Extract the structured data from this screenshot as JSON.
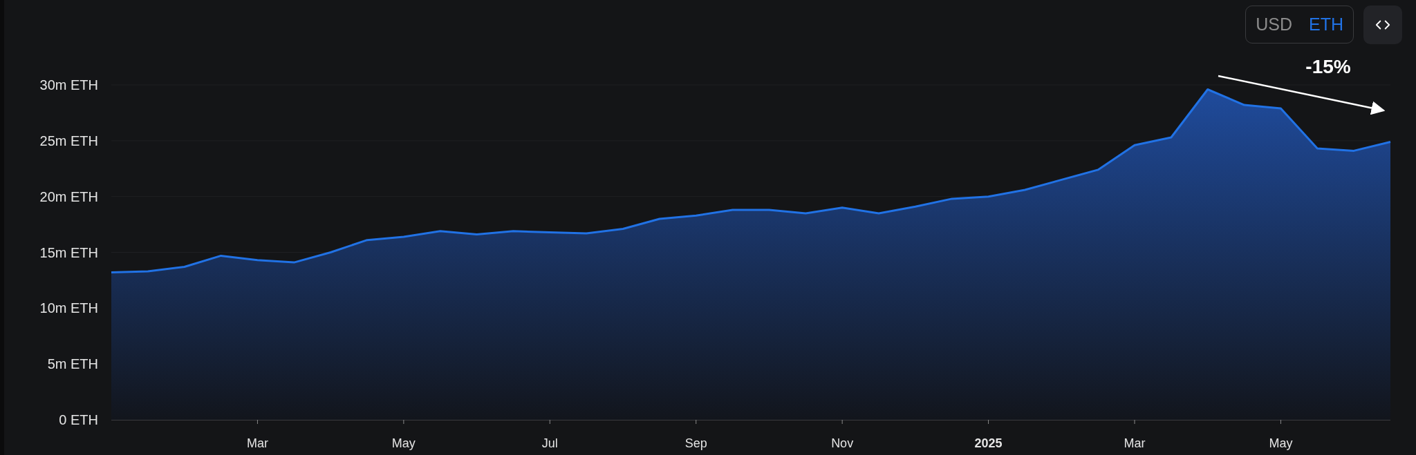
{
  "currency_toggle": [
    {
      "label": "USD",
      "selected": false
    },
    {
      "label": "ETH",
      "selected": true
    }
  ],
  "chart": {
    "chart_data": {
      "type": "area",
      "grid": true,
      "ylim": [
        0,
        30
      ],
      "yticks": [
        {
          "value": 0,
          "label": "0 ETH"
        },
        {
          "value": 5,
          "label": "5m ETH"
        },
        {
          "value": 10,
          "label": "10m ETH"
        },
        {
          "value": 15,
          "label": "15m ETH"
        },
        {
          "value": 20,
          "label": "20m ETH"
        },
        {
          "value": 25,
          "label": "25m ETH"
        },
        {
          "value": 30,
          "label": "30m ETH"
        }
      ],
      "categories": [
        null,
        null,
        null,
        null,
        "Mar",
        null,
        null,
        null,
        "May",
        null,
        null,
        null,
        "Jul",
        null,
        null,
        null,
        "Sep",
        null,
        null,
        null,
        "Nov",
        null,
        null,
        null,
        "2025",
        null,
        null,
        null,
        "Mar",
        null,
        null,
        null,
        "May",
        null,
        null,
        null
      ],
      "series": [
        {
          "color": "#2172e5",
          "values": [
            13.2,
            13.3,
            13.7,
            14.7,
            14.3,
            14.1,
            15.0,
            16.1,
            16.4,
            16.9,
            16.6,
            16.9,
            16.8,
            16.7,
            17.1,
            18.0,
            18.3,
            18.8,
            18.8,
            18.5,
            19.0,
            18.5,
            19.1,
            19.8,
            20.0,
            20.6,
            21.5,
            22.4,
            24.6,
            25.3,
            29.6,
            28.2,
            27.9,
            24.3,
            24.1,
            24.9
          ]
        }
      ],
      "annotations": [
        {
          "text": "-15%"
        }
      ]
    }
  }
}
